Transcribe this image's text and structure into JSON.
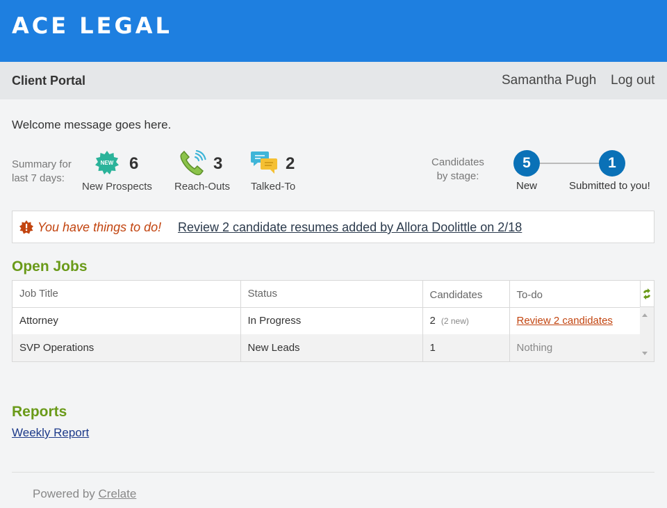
{
  "brand": {
    "name": "ACE LEGAL",
    "color": "#1e7fe0"
  },
  "subheader": {
    "title": "Client Portal",
    "user_name": "Samantha Pugh",
    "logout_label": "Log out"
  },
  "welcome": "Welcome message goes here.",
  "summary": {
    "label_line1": "Summary for",
    "label_line2": "last 7 days:",
    "stats": [
      {
        "icon": "new-badge-icon",
        "value": "6",
        "label": "New Prospects",
        "badge_text": "NEW"
      },
      {
        "icon": "phone-icon",
        "value": "3",
        "label": "Reach-Outs"
      },
      {
        "icon": "chat-bubbles-icon",
        "value": "2",
        "label": "Talked-To"
      }
    ]
  },
  "stages": {
    "label_line1": "Candidates",
    "label_line2": "by stage:",
    "items": [
      {
        "count": "5",
        "name": "New"
      },
      {
        "count": "1",
        "name": "Submitted to you!"
      }
    ],
    "color": "#0a71b7"
  },
  "todo": {
    "warning": "You have things to do!",
    "link": "Review 2 candidate resumes added by Allora Doolittle on 2/18",
    "color": "#c2440f"
  },
  "open_jobs": {
    "heading": "Open Jobs",
    "columns": [
      "Job Title",
      "Status",
      "Candidates",
      "To-do"
    ],
    "rows": [
      {
        "title": "Attorney",
        "status": "In Progress",
        "candidates": "2",
        "candidates_note": "(2 new)",
        "todo": "Review 2 candidates"
      },
      {
        "title": "SVP Operations",
        "status": "New Leads",
        "candidates": "1",
        "candidates_note": "",
        "todo": "Nothing"
      }
    ]
  },
  "reports": {
    "heading": "Reports",
    "items": [
      "Weekly Report"
    ]
  },
  "footer": {
    "powered_by": "Powered by",
    "link": "Crelate"
  },
  "accent_green": "#6a9a19"
}
